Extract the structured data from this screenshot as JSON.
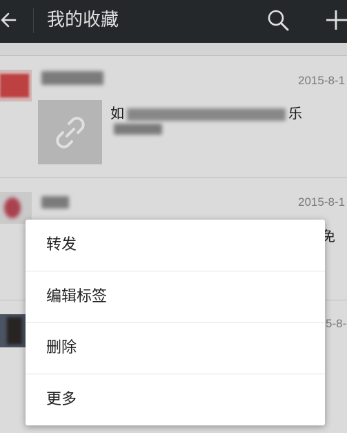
{
  "header": {
    "title": "我的收藏",
    "back_icon": "back-arrow-icon",
    "search_icon": "search-icon",
    "add_icon": "plus-icon",
    "background": "#2b2e31"
  },
  "favorites": [
    {
      "date": "2015-8-1",
      "link_title_visible": "如",
      "link_title_tail": "乐",
      "thumb_icon": "link-icon"
    },
    {
      "date": "2015-8-1",
      "snippet_tail": "免"
    },
    {
      "date": "5-8-"
    }
  ],
  "context_menu": {
    "items": [
      {
        "label": "转发"
      },
      {
        "label": "编辑标签"
      },
      {
        "label": "删除"
      },
      {
        "label": "更多"
      }
    ]
  }
}
